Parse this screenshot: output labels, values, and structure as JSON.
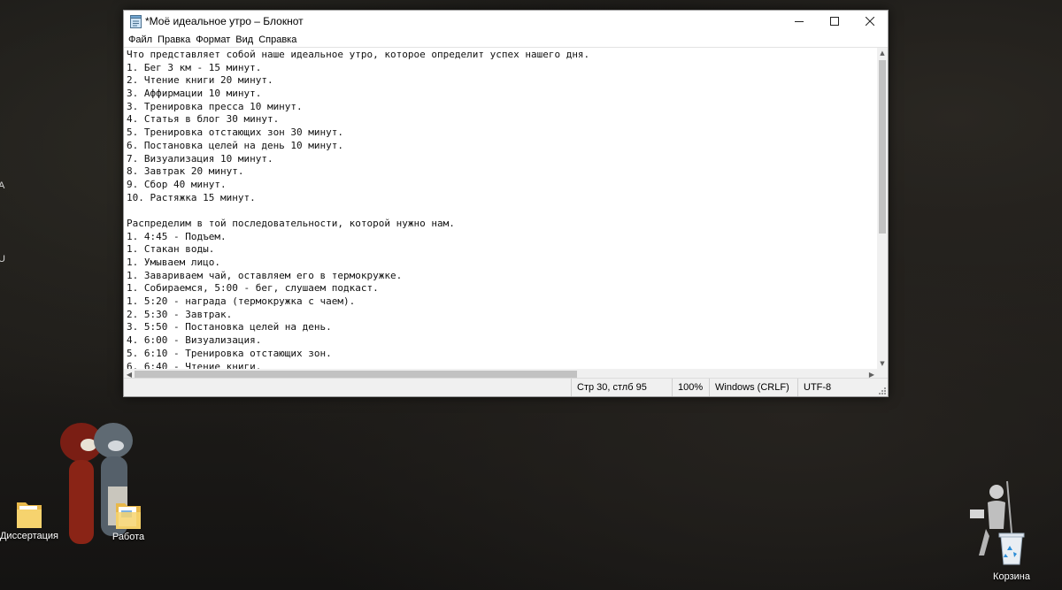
{
  "window": {
    "title": "*Моё идеальное утро – Блокнот",
    "controls": {
      "minimize": "—",
      "maximize": "☐",
      "close": "✕"
    }
  },
  "menu": [
    "Файл",
    "Правка",
    "Формат",
    "Вид",
    "Справка"
  ],
  "editor": {
    "lines": [
      "Что представляет собой наше идеальное утро, которое определит успех нашего дня.",
      "1. Бег 3 км - 15 минут.",
      "2. Чтение книги 20 минут.",
      "3. Аффирмации 10 минут.",
      "3. Тренировка пресса 10 минут.",
      "4. Статья в блог 30 минут.",
      "5. Тренировка отстающих зон 30 минут.",
      "6. Постановка целей на день 10 минут.",
      "7. Визуализация 10 минут.",
      "8. Завтрак 20 минут.",
      "9. Сбор 40 минут.",
      "10. Растяжка 15 минут.",
      "",
      "Распределим в той последовательности, которой нужно нам.",
      "1. 4:45 - Подъем.",
      "1. Стакан воды.",
      "1. Умываем лицо.",
      "1. Завариваем чай, оставляем его в термокружке.",
      "1. Собираемся, 5:00 - бег, слушаем подкаст.",
      "1. 5:20 - награда (термокружка с чаем).",
      "2. 5:30 - Завтрак.",
      "3. 5:50 - Постановка целей на день.",
      "4. 6:00 - Визуализация.",
      "5. 6:10 - Тренировка отстающих зон.",
      "6. 6:40 - Чтение книги."
    ]
  },
  "status": {
    "position": "Стр 30, стлб 95",
    "zoom": "100%",
    "line_endings": "Windows (CRLF)",
    "encoding": "UTF-8"
  },
  "desktop": {
    "icons": [
      {
        "label": "Диссертация",
        "type": "folder"
      },
      {
        "label": "Работа",
        "type": "folder"
      },
      {
        "label": "Корзина",
        "type": "recycle-bin"
      }
    ],
    "edge_glyphs": [
      "A",
      "U"
    ]
  }
}
